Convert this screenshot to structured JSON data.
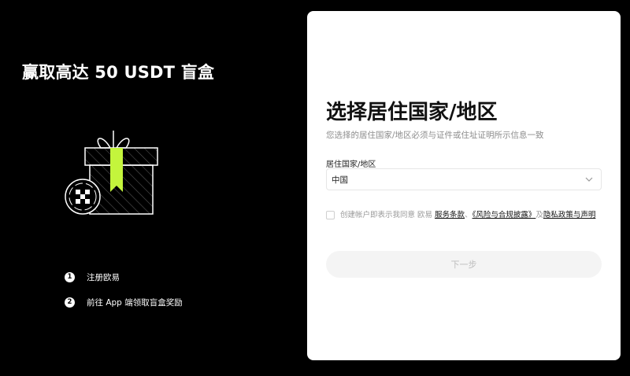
{
  "promo": {
    "title": "赢取高达 50 USDT 盲盒",
    "steps": [
      {
        "num": "1",
        "label": "注册欧易"
      },
      {
        "num": "2",
        "label": "前往 App 端领取盲盒奖励"
      }
    ]
  },
  "form": {
    "title": "选择居住国家/地区",
    "subtitle": "您选择的居住国家/地区必须与证件或住址证明所示信息一致",
    "country_label": "居住国家/地区",
    "country_value": "中国",
    "agree_prefix": "创建帐户即表示我同意 欧易 ",
    "terms_link": "服务条款",
    "sep1": "、",
    "risk_link": "《风险与合规披露》",
    "sep2": "及",
    "privacy_link": "隐私政策与声明",
    "next_label": "下一步"
  },
  "colors": {
    "background": "#000000",
    "accent_green": "#c4f53c",
    "card": "#ffffff",
    "disabled_button": "#f4f4f4"
  },
  "icons": [
    "gift-box-icon",
    "okx-logo-icon",
    "chevron-down-icon",
    "checkbox-icon"
  ]
}
